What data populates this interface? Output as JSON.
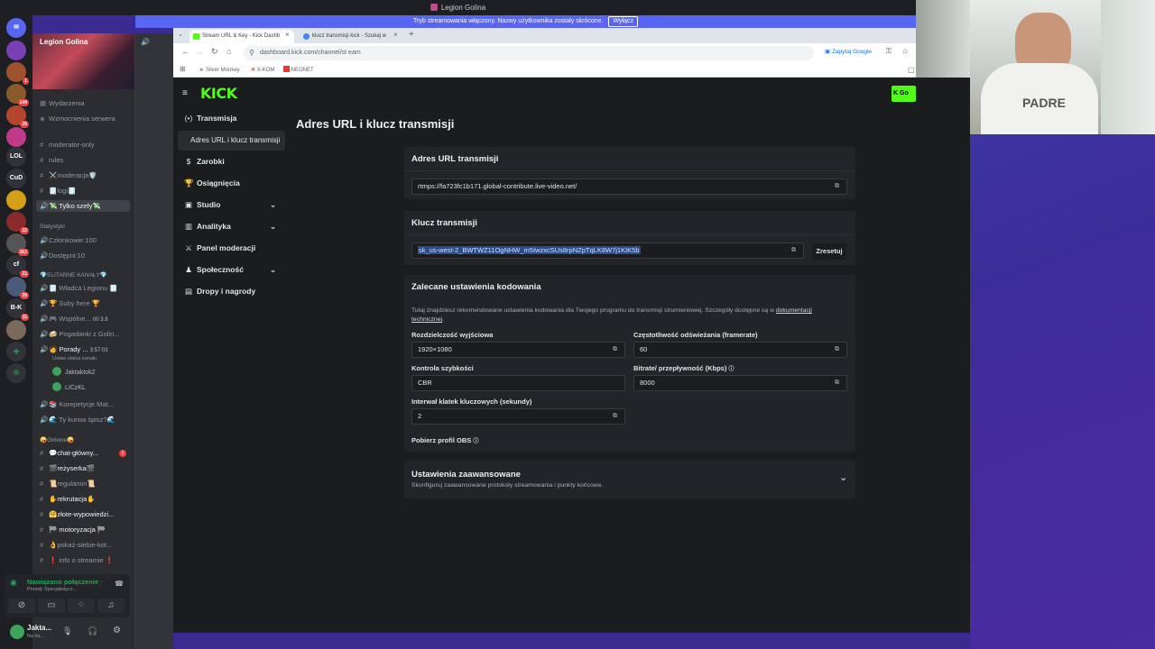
{
  "discord": {
    "window_title": "Legion Golina",
    "banner_text": "Tryb streamowania włączony. Nazwy użytkownika zostały skrócone.",
    "banner_button": "Wyłącz",
    "server_name": "Legion Golina",
    "top_items": [
      "Wydarzenia",
      "Wzmocnienia serwera"
    ],
    "channels": [
      {
        "label": "moderator-only",
        "type": "text"
      },
      {
        "label": "rules",
        "type": "text"
      },
      {
        "label": "⚔️moderacja🛡️",
        "type": "text"
      },
      {
        "label": "🗒️logi🗒️",
        "type": "text"
      },
      {
        "label": "💸 Tylko szefy💸",
        "type": "voice"
      }
    ],
    "stats_category": "Statystyki",
    "stats": [
      "Członkowie:100",
      "Dostępni:10"
    ],
    "elite_category": "💎ELITARNE KANAŁY💎",
    "elite_channels": [
      {
        "label": "🗒️ Władca Legionu 🗒️",
        "type": "voice"
      },
      {
        "label": "🏆 Suby here 🏆",
        "type": "voice"
      },
      {
        "label": "🎮 Wspólne...",
        "type": "voice",
        "extra": "00 3.8"
      },
      {
        "label": "🍻 Pogadanki z Golin...",
        "type": "voice"
      },
      {
        "label": "🧑 Porady ...",
        "type": "voice",
        "extra": "3:57:03"
      }
    ],
    "status_hint": "Ustaw status kanału",
    "voice_users": [
      "Jaktaktok2",
      "LICzKL"
    ],
    "more_channels": [
      {
        "label": "📚 Korepetycje Mat...",
        "type": "voice"
      },
      {
        "label": "🌊 Ty kurwa śpisz?🌊",
        "type": "voice"
      }
    ],
    "main_category": "🤪Główne🤪",
    "main_channels": [
      {
        "label": "💬chat-główny...",
        "badge": "1"
      },
      {
        "label": "🎬reżyserka🎬"
      },
      {
        "label": "📜regulamin📜"
      },
      {
        "label": "✋rekrutacja✋"
      },
      {
        "label": "🤗złote-wypowiedzi..."
      },
      {
        "label": "🏁 motoryzacja 🏁"
      },
      {
        "label": "👌pokaż-siebie-kot..."
      },
      {
        "label": "❗ info o streamie ❗"
      }
    ],
    "voice_status": "Nawiązano połączenie",
    "voice_channel": "Porady Specjalistycz...",
    "user_name": "Jakta...",
    "user_status": "Na ka...",
    "rail_labels": [
      "LOL",
      "CuD",
      "cf",
      "B-K"
    ],
    "rail_badges": [
      "1",
      "144",
      "26",
      "32",
      "362",
      "21",
      "39",
      "11"
    ]
  },
  "browser": {
    "tabs": [
      {
        "title": "Stream URL & Key - Kick Dashb",
        "active": true
      },
      {
        "title": "klucz transmisji kick - Szukaj w",
        "active": false
      }
    ],
    "url": "dashboard.kick.com/channel/st eam",
    "google_button": "Zapytaj Google",
    "bookmarks": [
      "Silver Monkey",
      "X-KOM",
      "NEONET"
    ]
  },
  "kick": {
    "logo": "KICK",
    "go_button": "Go",
    "nav": [
      {
        "label": "Transmisja",
        "icon": "(•)",
        "chevron": false
      },
      {
        "label": "Zarobki",
        "icon": "$",
        "chevron": false
      },
      {
        "label": "Osiągnięcia",
        "icon": "🏆",
        "chevron": false
      },
      {
        "label": "Studio",
        "icon": "▣",
        "chevron": true
      },
      {
        "label": "Analityka",
        "icon": "▥",
        "chevron": true
      },
      {
        "label": "Panel moderacji",
        "icon": "⚔",
        "chevron": false
      },
      {
        "label": "Społeczność",
        "icon": "♟",
        "chevron": true
      },
      {
        "label": "Dropy i nagrody",
        "icon": "▤",
        "chevron": false
      }
    ],
    "subnav_active": "Adres URL i klucz transmisji",
    "page_title": "Adres URL i klucz transmisji",
    "url_section": {
      "title": "Adres URL transmisji",
      "value": "rtmps://fa723fc1b171.global-contribute.live-video.net/"
    },
    "key_section": {
      "title": "Klucz transmisji",
      "value": "sk_us-west-2_BWTWZ11OgNHW_m5IwzxcSUs8rpNZpTqLK8W7j1KIK5b",
      "reset": "Zresetuj"
    },
    "encoding": {
      "title": "Zalecane ustawienia kodowania",
      "desc": "Tutaj znajdziesz rekomendowane ustawienia kodowania dla Twojego programu do transmisji strumieniowej. Szczegóły dostępne są w",
      "desc_link": "dokumentacji technicznej",
      "resolution_label": "Rozdzielczość wyjściowa",
      "resolution": "1920×1080",
      "framerate_label": "Częstotliwość odświeżania (framerate)",
      "framerate": "60",
      "rate_control_label": "Kontrola szybkości",
      "rate_control": "CBR",
      "bitrate_label": "Bitrate/ przepływność (Kbps)",
      "bitrate": "8000",
      "keyframe_label": "Interwał klatek kluczowych (sekundy)",
      "keyframe": "2",
      "obs_profile": "Pobierz profil OBS"
    },
    "advanced": {
      "title": "Ustawienia zaawansowane",
      "desc": "Skonfiguruj zaawansowane protokoły streamowania i punkty końcowe."
    }
  },
  "colors": {
    "kick_green": "#53fc18",
    "discord_blurple": "#5865f2",
    "kick_bg": "#1b1c1e",
    "card_bg": "#232427"
  }
}
